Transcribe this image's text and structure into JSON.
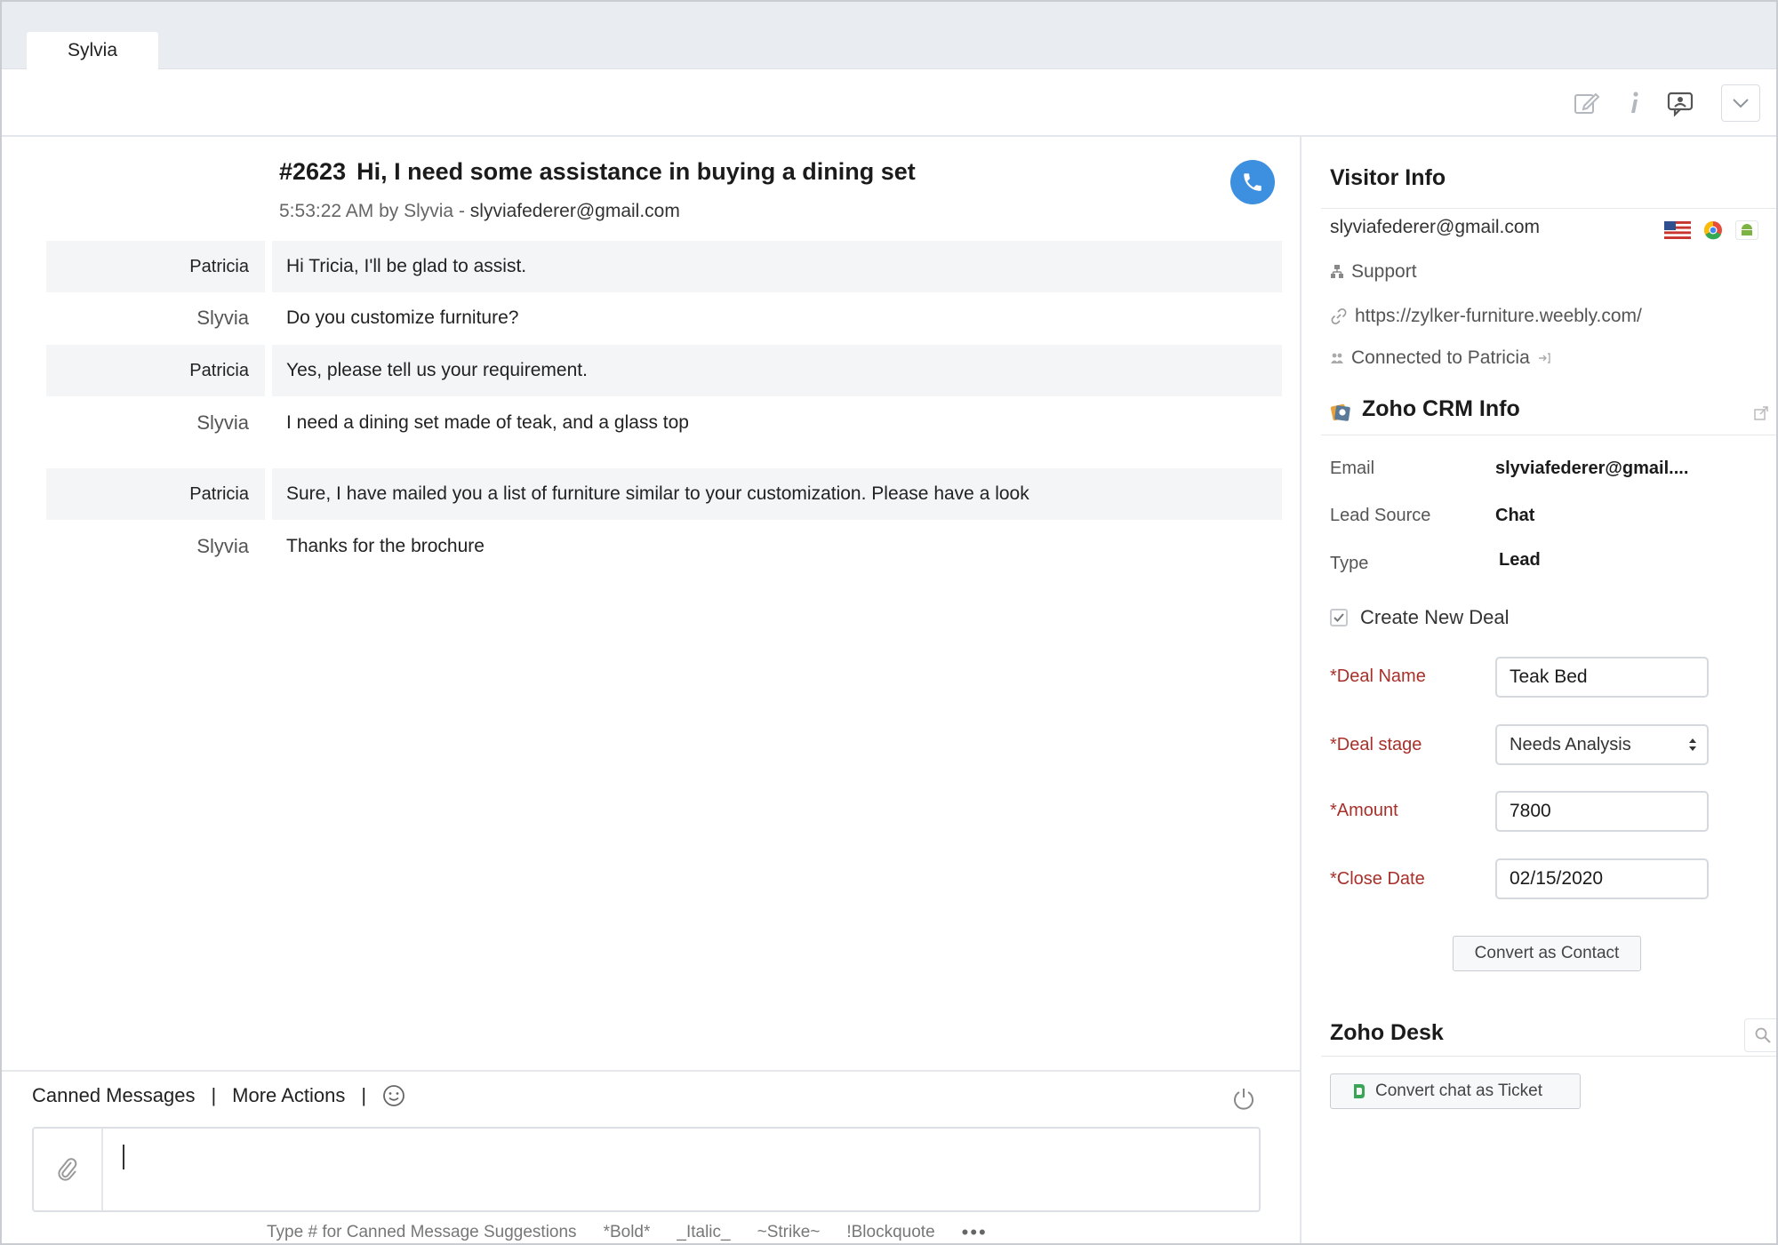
{
  "tabs": [
    {
      "label": "Sylvia"
    }
  ],
  "ticket": {
    "number": "#2623",
    "subject": "Hi, I need some assistance in buying a dining set",
    "meta_time": "5:53:22 AM by Slyvia -",
    "meta_email": "slyviafederer@gmail.com"
  },
  "messages": [
    {
      "sender": "Patricia",
      "text": "Hi Tricia, I'll be glad to assist."
    },
    {
      "sender": "Slyvia",
      "text": "Do you customize furniture?"
    },
    {
      "sender": "Patricia",
      "text": "Yes, please tell us your requirement."
    },
    {
      "sender": "Slyvia",
      "text": "I need a dining set made of teak, and a glass top"
    },
    {
      "sender": "Patricia",
      "text": "Sure, I have mailed you a list of furniture similar to your customization. Please have a look"
    },
    {
      "sender": "Slyvia",
      "text": "Thanks for the brochure"
    }
  ],
  "composer": {
    "canned": "Canned Messages",
    "more": "More Actions",
    "sep": "|",
    "hints": [
      "Type # for Canned Message Suggestions",
      "*Bold*",
      "_Italic_",
      "~Strike~",
      "!Blockquote"
    ],
    "more_dots": "•••"
  },
  "visitor": {
    "title": "Visitor Info",
    "email": "slyviafederer@gmail.com",
    "department": "Support",
    "url": "https://zylker-furniture.weebly.com/",
    "connected": "Connected to Patricia"
  },
  "crm": {
    "title": "Zoho CRM Info",
    "email_label": "Email",
    "email_value": "slyviafederer@gmail....",
    "lead_source_label": "Lead Source",
    "lead_source_value": "Chat",
    "type_label": "Type",
    "type_value": "Lead",
    "create_deal": "Create New Deal",
    "deal_name_label": "*Deal Name",
    "deal_name_value": "Teak Bed",
    "deal_stage_label": "*Deal stage",
    "deal_stage_value": "Needs Analysis",
    "amount_label": "*Amount",
    "amount_value": "7800",
    "close_date_label": "*Close Date",
    "close_date_value": "02/15/2020",
    "convert_contact": "Convert as Contact"
  },
  "desk": {
    "title": "Zoho Desk",
    "convert_ticket": "Convert chat as Ticket"
  },
  "colors": {
    "accent_blue": "#3d8fe0",
    "required_red": "#a8302a",
    "row_shade": "#f4f5f7",
    "tab_strip": "#e9edf1"
  }
}
